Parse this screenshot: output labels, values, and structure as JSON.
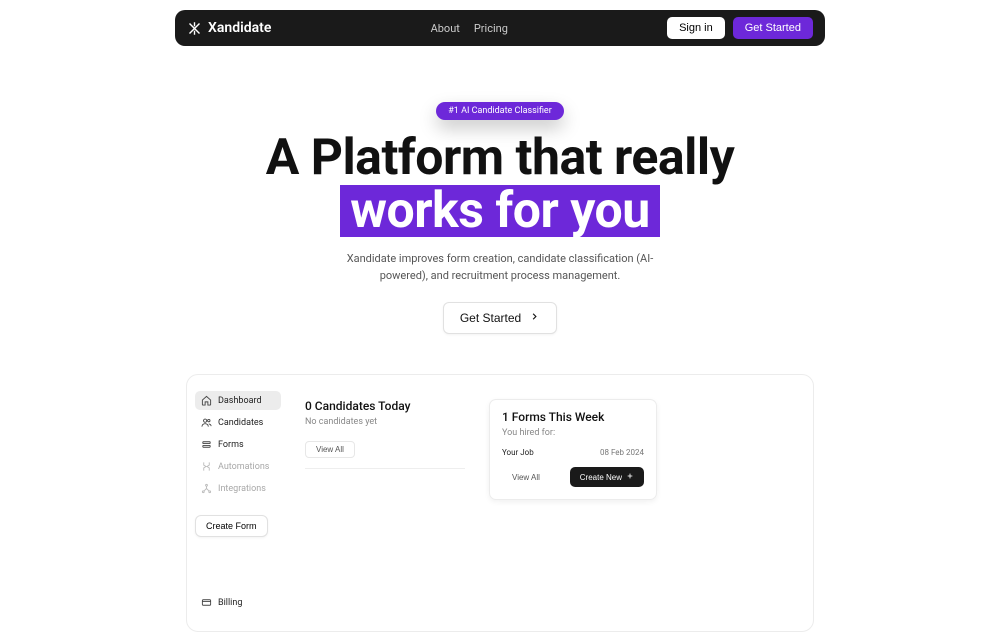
{
  "nav": {
    "brand": "Xandidate",
    "links": {
      "about": "About",
      "pricing": "Pricing"
    },
    "signin": "Sign in",
    "getstarted": "Get Started"
  },
  "hero": {
    "badge": "#1 AI Candidate Classifier",
    "title_line1": "A Platform that really",
    "title_highlight": "works for you",
    "subtitle": "Xandidate improves form creation, candidate classification (AI-powered), and recruitment process management.",
    "cta": "Get Started"
  },
  "sidebar": {
    "items": [
      {
        "label": "Dashboard",
        "active": true
      },
      {
        "label": "Candidates"
      },
      {
        "label": "Forms"
      },
      {
        "label": "Automations",
        "muted": true
      },
      {
        "label": "Integrations",
        "muted": true
      }
    ],
    "createform": "Create Form",
    "billing": "Billing"
  },
  "dashboard": {
    "candidates": {
      "title": "0 Candidates Today",
      "empty": "No candidates yet",
      "viewall": "View All"
    },
    "forms": {
      "title": "1 Forms This Week",
      "hired_label": "You hired for:",
      "job": "Your Job",
      "date": "08 Feb 2024",
      "viewall": "View All",
      "createnew": "Create New"
    }
  }
}
